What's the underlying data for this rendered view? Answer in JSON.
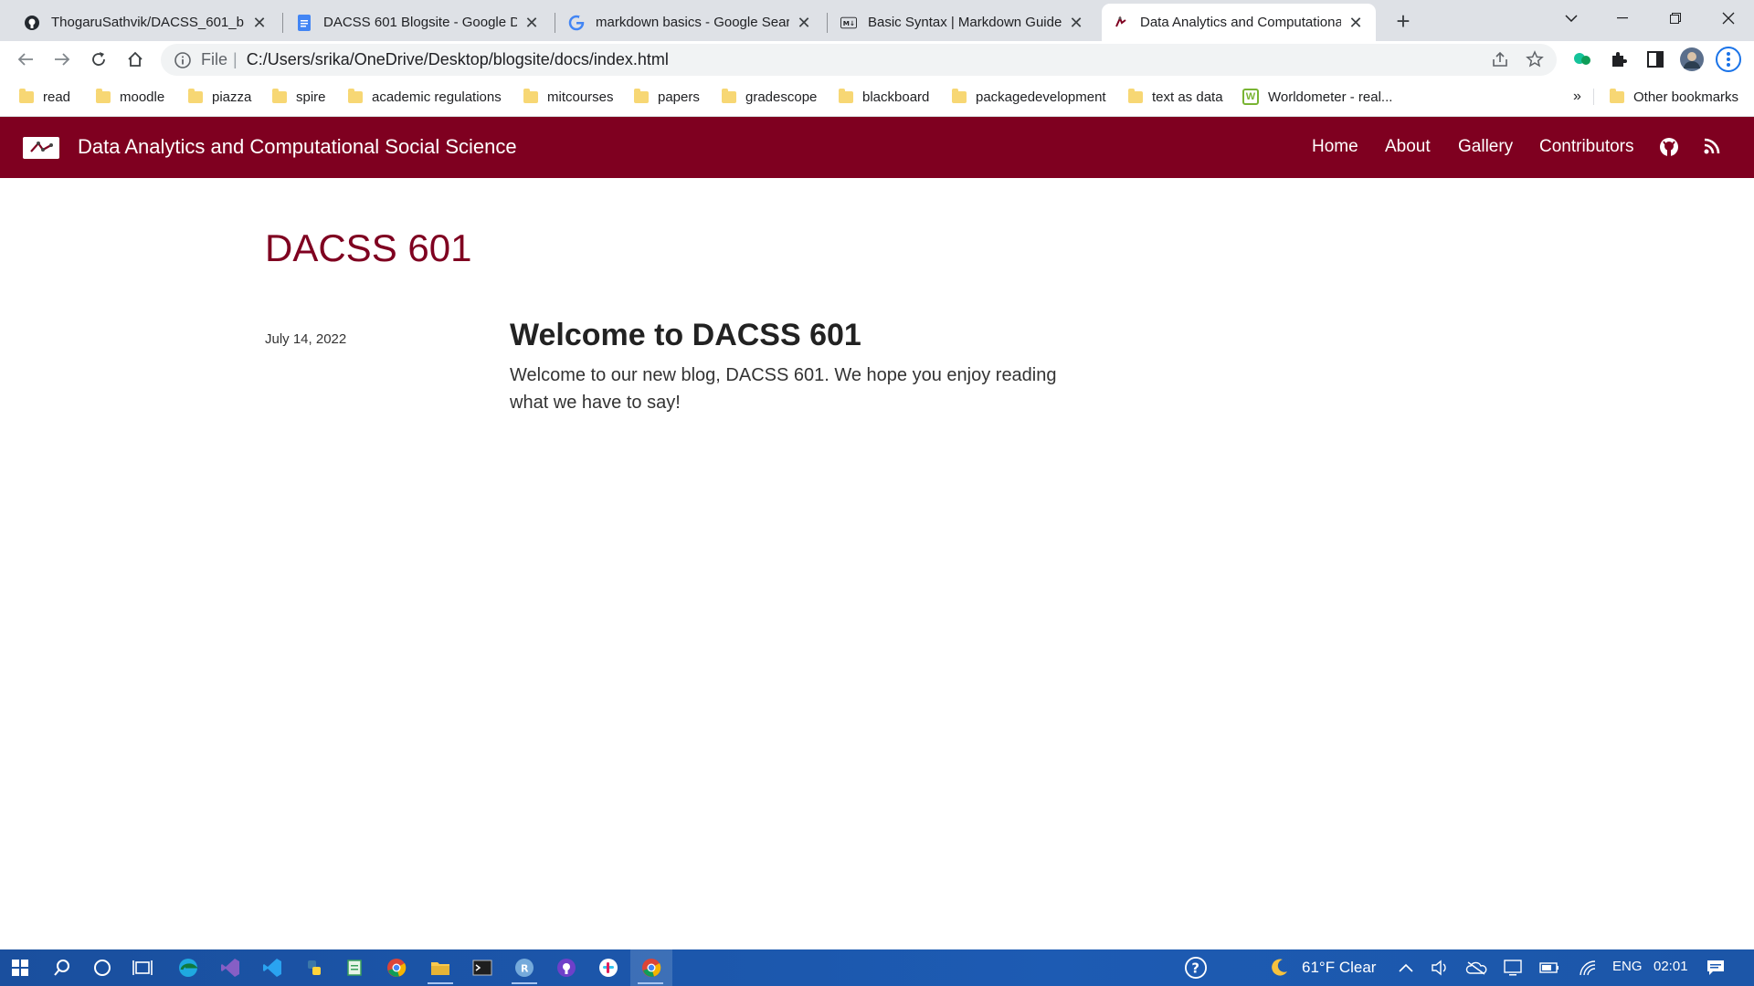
{
  "browser": {
    "tabs": [
      {
        "title": "ThogaruSathvik/DACSS_601_blog",
        "icon": "github-icon",
        "active": false
      },
      {
        "title": "DACSS 601 Blogsite - Google Do",
        "icon": "google-docs-icon",
        "active": false
      },
      {
        "title": "markdown basics - Google Searc",
        "icon": "google-icon",
        "active": false
      },
      {
        "title": "Basic Syntax | Markdown Guide",
        "icon": "markdown-icon",
        "active": false
      },
      {
        "title": "Data Analytics and Computationa",
        "icon": "site-favicon-icon",
        "active": true
      }
    ],
    "address": {
      "scheme": "File",
      "url": "C:/Users/srika/OneDrive/Desktop/blogsite/docs/index.html"
    },
    "bookmarks": [
      {
        "label": "read"
      },
      {
        "label": "moodle"
      },
      {
        "label": "piazza"
      },
      {
        "label": "spire"
      },
      {
        "label": "academic regulations"
      },
      {
        "label": "mitcourses"
      },
      {
        "label": "papers"
      },
      {
        "label": "gradescope"
      },
      {
        "label": "blackboard"
      },
      {
        "label": "packagedevelopment"
      },
      {
        "label": "text as data"
      },
      {
        "label": "Worldometer - real..."
      }
    ],
    "more_bookmarks": "»",
    "other_bookmarks": "Other bookmarks"
  },
  "site": {
    "title": "Data Analytics and Computational Social Science",
    "nav": [
      "Home",
      "About",
      "Gallery",
      "Contributors"
    ],
    "accent_color": "#7f0020"
  },
  "page": {
    "heading": "DACSS 601",
    "post": {
      "date": "July 14, 2022",
      "title": "Welcome to DACSS 601",
      "description": "Welcome to our new blog, DACSS 601. We hope you enjoy reading what we have to say!"
    }
  },
  "taskbar": {
    "weather": "61°F  Clear",
    "language": "ENG",
    "time": "02:01"
  }
}
